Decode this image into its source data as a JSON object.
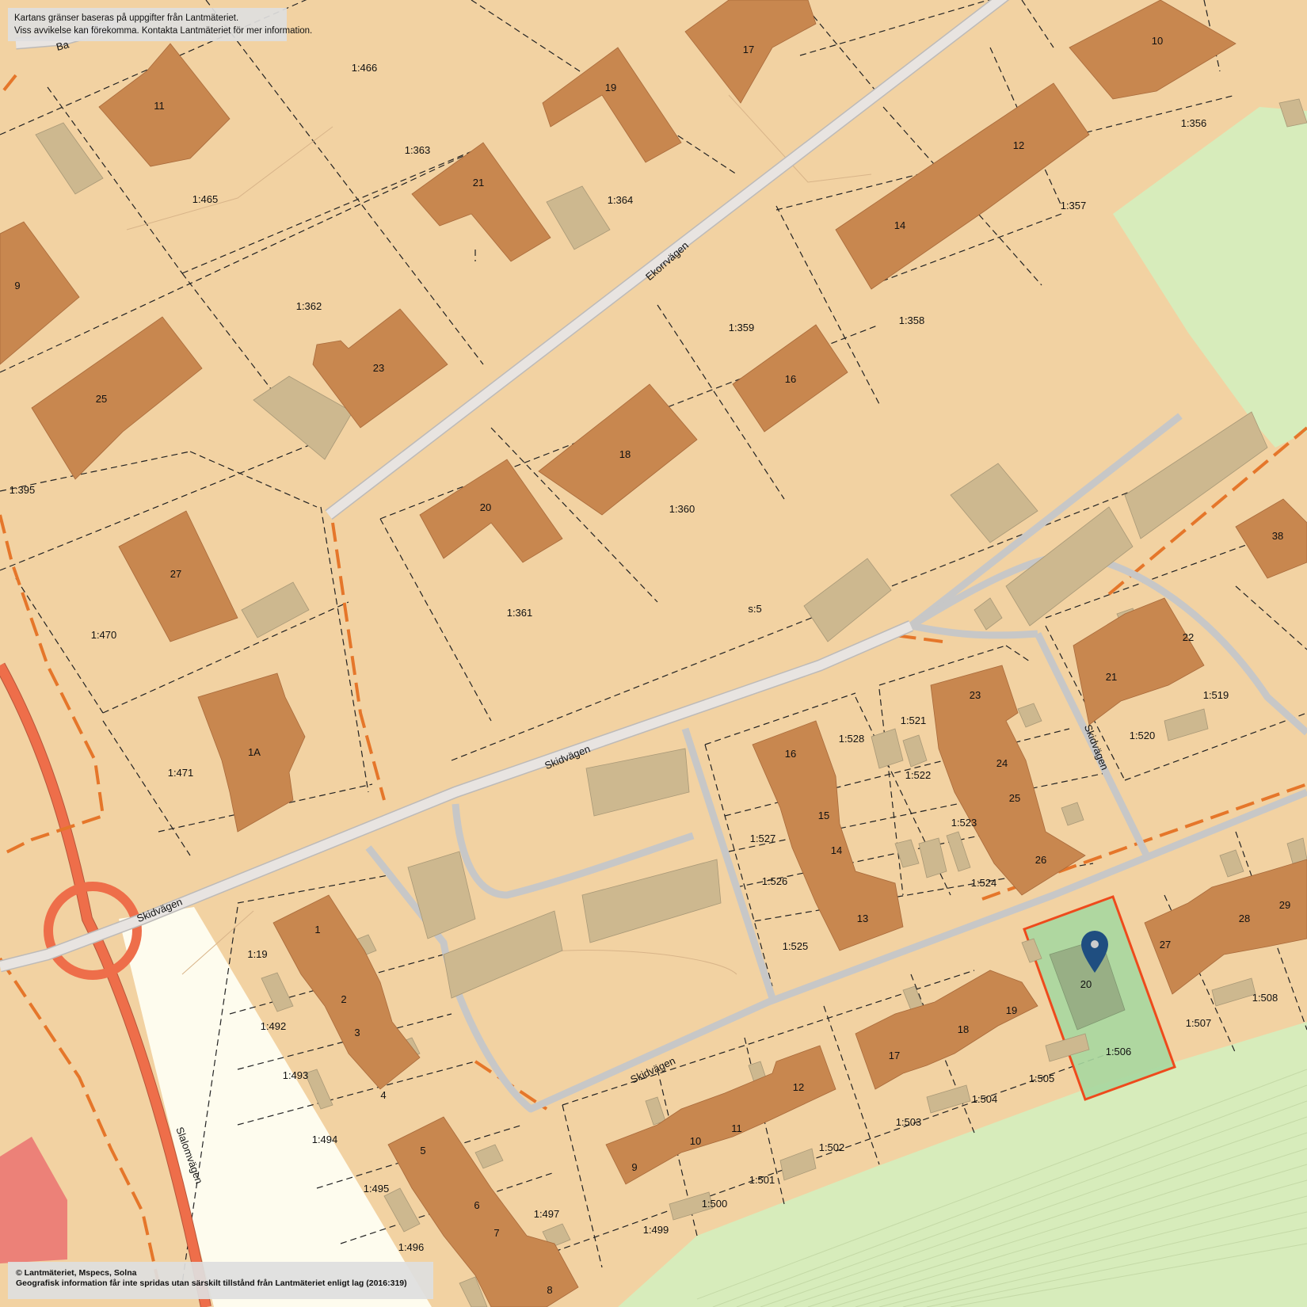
{
  "notices": {
    "top_line1": "Kartans gränser baseras på uppgifter från Lantmäteriet.",
    "top_line2": "Viss avvikelse kan förekomma. Kontakta Lantmäteriet för mer information.",
    "bottom_line1": "© Lantmäteriet, Mspecs, Solna",
    "bottom_line2": "Geografisk information får inte spridas utan särskilt tillstånd från Lantmäteriet enligt lag (2016:319)"
  },
  "colors": {
    "land": "#f2d2a2",
    "building": "#c8874f",
    "outbuilding": "#cdb88f",
    "green": "#d7ecbb",
    "road": "#e8e4e1",
    "road_grey": "#c7c7c7",
    "main_road": "#ee6e4a",
    "selected_fill": "#a7d7a0",
    "selected_border": "#ee4a1c",
    "pin": "#1f4e80"
  },
  "marker": {
    "icon": "map-pin-icon",
    "parcel": "1:506"
  },
  "roads": [
    {
      "id": "ekorrvagen",
      "name": "Ekorrvägen"
    },
    {
      "id": "skidvagen-1",
      "name": "Skidvägen"
    },
    {
      "id": "skidvagen-2",
      "name": "Skidvägen"
    },
    {
      "id": "skidvagen-3",
      "name": "Skidvägen"
    },
    {
      "id": "skidvagen-4",
      "name": "Skidvägen"
    },
    {
      "id": "slalomvagen",
      "name": "Slalomvägen"
    },
    {
      "id": "partial-road",
      "name": "Ba"
    }
  ],
  "house_numbers": [
    "11",
    "9",
    "25",
    "27",
    "1A",
    "21",
    "23",
    "19",
    "17",
    "10",
    "12",
    "14",
    "16",
    "18",
    "20",
    "38",
    "22",
    "21",
    "23",
    "24",
    "25",
    "26",
    "16",
    "15",
    "14",
    "13",
    "1",
    "2",
    "3",
    "4",
    "5",
    "6",
    "7",
    "8",
    "9",
    "10",
    "11",
    "12",
    "17",
    "18",
    "19",
    "20",
    "27",
    "28",
    "29"
  ],
  "parcels": [
    "1:466",
    "1:465",
    "1:363",
    "1:364",
    "1:362",
    "1:395",
    "1:470",
    "1:471",
    "1:356",
    "1:357",
    "1:358",
    "1:359",
    "1:360",
    "1:361",
    "s:5",
    "1:528",
    "1:521",
    "1:522",
    "1:519",
    "1:520",
    "1:527",
    "1:523",
    "1:526",
    "1:524",
    "1:525",
    "1:19",
    "1:492",
    "1:493",
    "1:494",
    "1:495",
    "1:496",
    "1:497",
    "1:499",
    "1:500",
    "1:501",
    "1:502",
    "1:503",
    "1:504",
    "1:505",
    "1:506",
    "1:507",
    "1:508"
  ]
}
